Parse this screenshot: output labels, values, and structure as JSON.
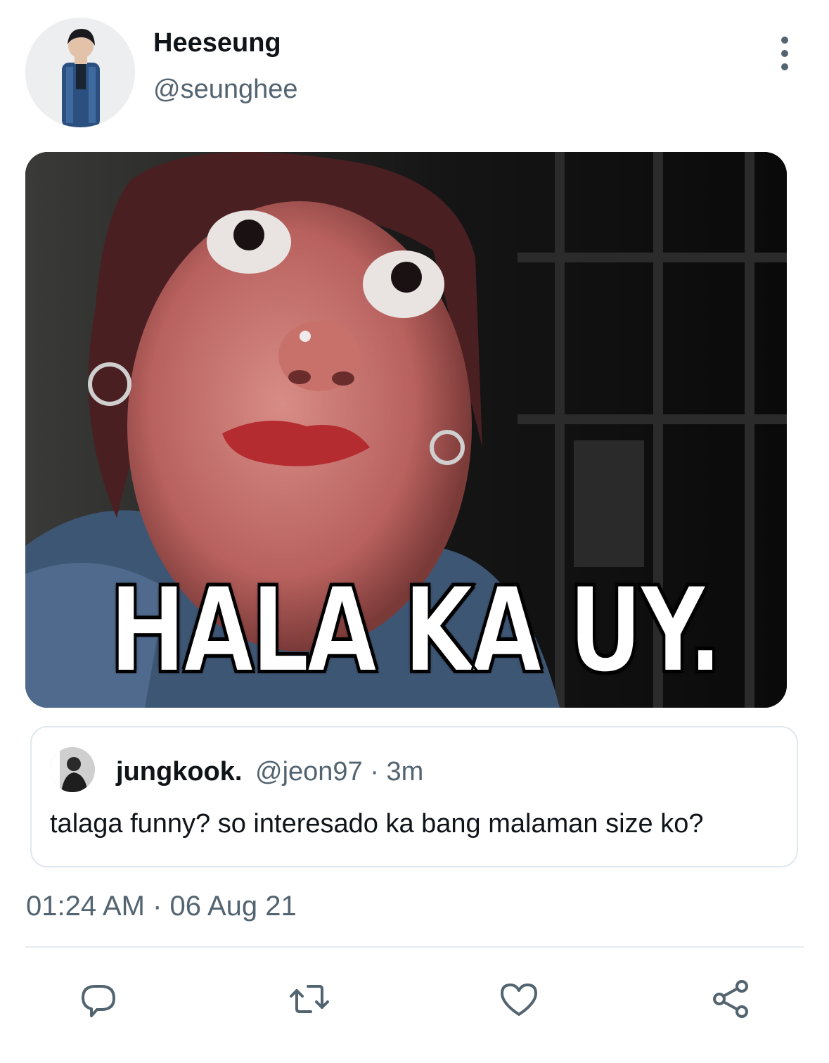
{
  "author": {
    "display_name": "Heeseung",
    "handle": "@seunghee"
  },
  "media": {
    "caption": "HALA KA UY."
  },
  "quoted_tweet": {
    "display_name": "jungkook.",
    "handle_time": "@jeon97 · 3m",
    "text": "talaga funny? so interesado ka bang malaman size ko?"
  },
  "timestamp": "01:24 AM · 06 Aug 21",
  "actions": {
    "icons": [
      "reply-icon",
      "retweet-icon",
      "like-icon",
      "share-icon"
    ]
  },
  "colors": {
    "secondary_text": "#536471",
    "primary_text": "#0f1419",
    "border": "#e1e8ed"
  }
}
